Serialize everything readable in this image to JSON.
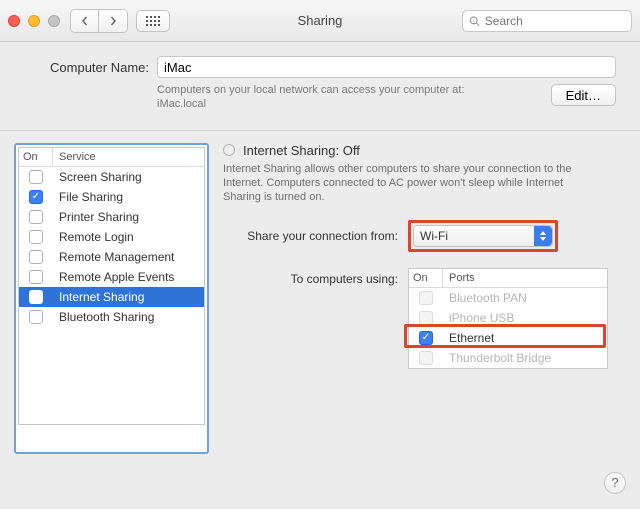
{
  "window": {
    "title": "Sharing"
  },
  "toolbar": {
    "search_placeholder": "Search"
  },
  "computer_name": {
    "label": "Computer Name:",
    "value": "iMac",
    "hint_line1": "Computers on your local network can access your computer at:",
    "hint_line2": "iMac.local",
    "edit_label": "Edit…"
  },
  "service_list": {
    "col_on": "On",
    "col_service": "Service",
    "items": [
      {
        "label": "Screen Sharing",
        "on": false,
        "selected": false
      },
      {
        "label": "File Sharing",
        "on": true,
        "selected": false
      },
      {
        "label": "Printer Sharing",
        "on": false,
        "selected": false
      },
      {
        "label": "Remote Login",
        "on": false,
        "selected": false
      },
      {
        "label": "Remote Management",
        "on": false,
        "selected": false
      },
      {
        "label": "Remote Apple Events",
        "on": false,
        "selected": false
      },
      {
        "label": "Internet Sharing",
        "on": false,
        "selected": true
      },
      {
        "label": "Bluetooth Sharing",
        "on": false,
        "selected": false
      }
    ]
  },
  "detail": {
    "heading": "Internet Sharing: Off",
    "description": "Internet Sharing allows other computers to share your connection to the Internet. Computers connected to AC power won't sleep while Internet Sharing is turned on.",
    "share_from_label": "Share your connection from:",
    "share_from_value": "Wi-Fi",
    "to_label": "To computers using:",
    "ports": {
      "col_on": "On",
      "col_ports": "Ports",
      "items": [
        {
          "label": "Bluetooth PAN",
          "on": false,
          "disabled": true
        },
        {
          "label": "iPhone USB",
          "on": false,
          "disabled": true
        },
        {
          "label": "Ethernet",
          "on": true,
          "disabled": false
        },
        {
          "label": "Thunderbolt Bridge",
          "on": false,
          "disabled": true
        }
      ]
    }
  },
  "annotations": {
    "hl_share_from": true,
    "hl_ethernet": true
  },
  "help_label": "?"
}
